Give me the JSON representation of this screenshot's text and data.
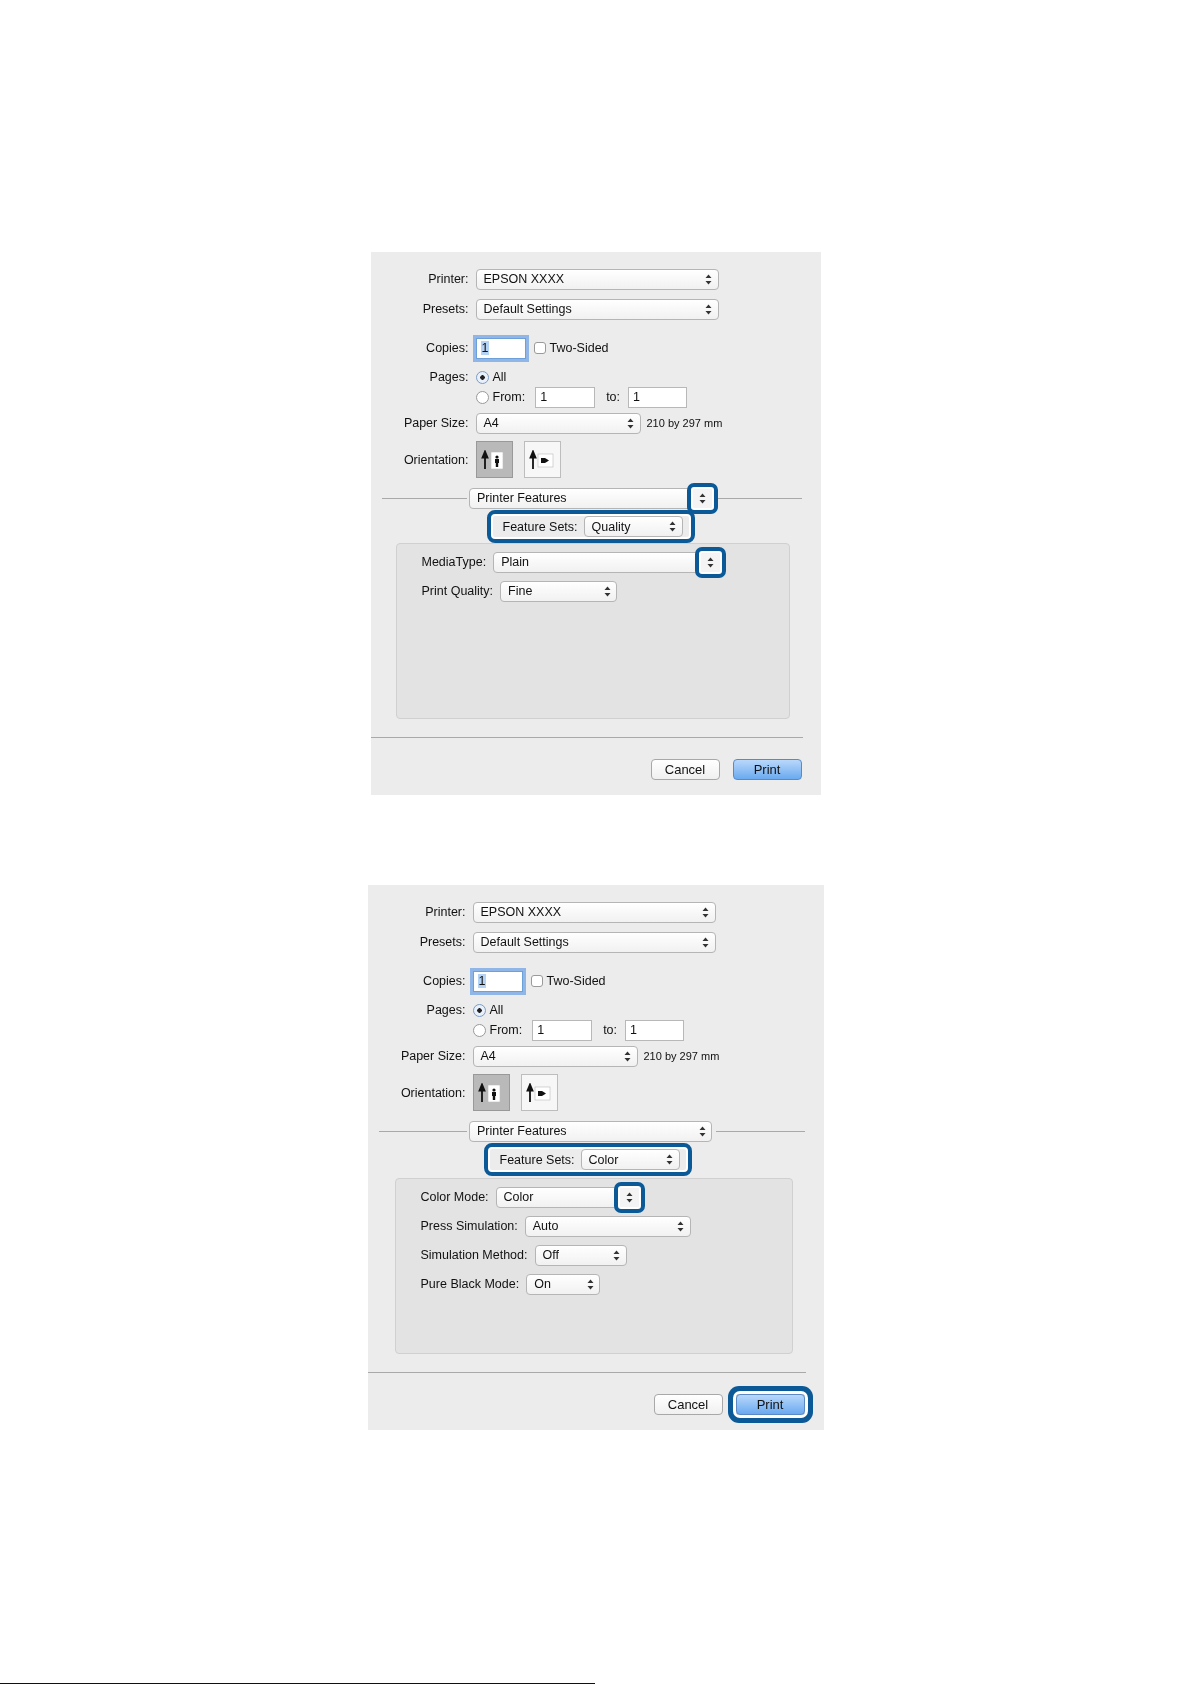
{
  "dialogs": [
    {
      "printer": {
        "label": "Printer:",
        "value": "EPSON XXXX"
      },
      "presets": {
        "label": "Presets:",
        "value": "Default Settings"
      },
      "copies": {
        "label": "Copies:",
        "value": "1"
      },
      "two_sided": {
        "label": "Two-Sided",
        "checked": false
      },
      "pages": {
        "label": "Pages:",
        "options": [
          {
            "label": "All",
            "selected": true
          },
          {
            "label": "From:",
            "selected": false
          }
        ],
        "from": "1",
        "to_label": "to:",
        "to": "1"
      },
      "paper_size": {
        "label": "Paper Size:",
        "value": "A4",
        "note": "210 by 297 mm"
      },
      "orientation": {
        "label": "Orientation:",
        "options": [
          {
            "kind": "portrait",
            "selected": true
          },
          {
            "kind": "landscape",
            "selected": false
          }
        ]
      },
      "panel_menu": {
        "value": "Printer Features",
        "arrows_highlighted": true
      },
      "feature_sets": {
        "label": "Feature Sets:",
        "value": "Quality",
        "highlighted": true
      },
      "settings": [
        {
          "label": "MediaType:",
          "value": "Plain",
          "arrows_highlighted": true
        },
        {
          "label": "Print Quality:",
          "value": "Fine",
          "arrows_highlighted": false
        }
      ],
      "buttons": [
        {
          "label": "Cancel",
          "kind": "normal",
          "highlighted": false
        },
        {
          "label": "Print",
          "kind": "default",
          "highlighted": false
        }
      ]
    },
    {
      "printer": {
        "label": "Printer:",
        "value": "EPSON XXXX"
      },
      "presets": {
        "label": "Presets:",
        "value": "Default Settings"
      },
      "copies": {
        "label": "Copies:",
        "value": "1"
      },
      "two_sided": {
        "label": "Two-Sided",
        "checked": false
      },
      "pages": {
        "label": "Pages:",
        "options": [
          {
            "label": "All",
            "selected": true
          },
          {
            "label": "From:",
            "selected": false
          }
        ],
        "from": "1",
        "to_label": "to:",
        "to": "1"
      },
      "paper_size": {
        "label": "Paper Size:",
        "value": "A4",
        "note": "210 by 297 mm"
      },
      "orientation": {
        "label": "Orientation:",
        "options": [
          {
            "kind": "portrait",
            "selected": true
          },
          {
            "kind": "landscape",
            "selected": false
          }
        ]
      },
      "panel_menu": {
        "value": "Printer Features",
        "arrows_highlighted": false
      },
      "feature_sets": {
        "label": "Feature Sets:",
        "value": "Color",
        "highlighted": true
      },
      "settings": [
        {
          "label": "Color Mode:",
          "value": "Color",
          "arrows_highlighted": true
        },
        {
          "label": "Press Simulation:",
          "value": "Auto",
          "arrows_highlighted": false
        },
        {
          "label": "Simulation Method:",
          "value": "Off",
          "arrows_highlighted": false
        },
        {
          "label": "Pure Black Mode:",
          "value": "On",
          "arrows_highlighted": false
        }
      ],
      "buttons": [
        {
          "label": "Cancel",
          "kind": "normal",
          "highlighted": false
        },
        {
          "label": "Print",
          "kind": "default",
          "highlighted": true
        }
      ]
    }
  ]
}
